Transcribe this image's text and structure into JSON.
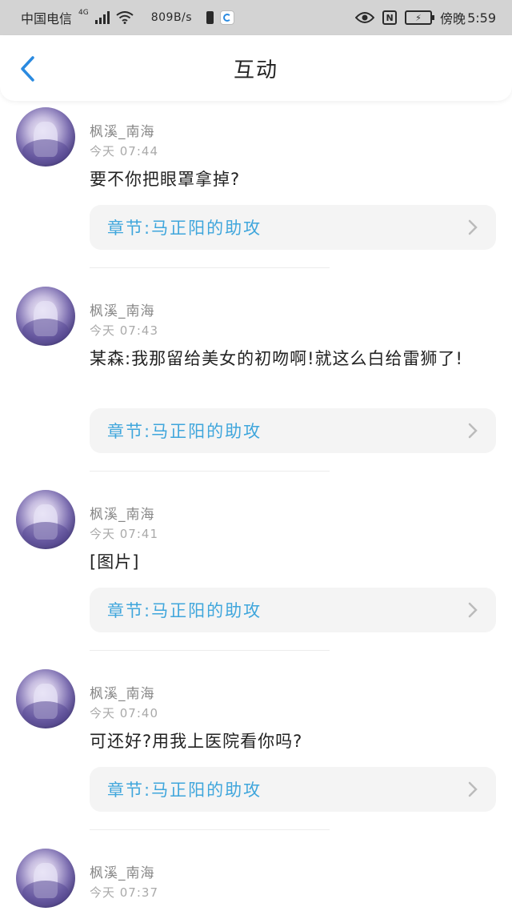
{
  "status_bar": {
    "carrier": "中国电信",
    "network": "4G",
    "speed": "809B/s",
    "alarm_label": "傍晚",
    "time": "5:59"
  },
  "header": {
    "title": "互动",
    "back_icon": "chevron-left-icon"
  },
  "colors": {
    "accent": "#3fa6dc",
    "back_arrow": "#2a8ae0"
  },
  "feed": [
    {
      "username": "枫溪_南海",
      "time": "今天 07:44",
      "comment": "要不你把眼罩拿掉?",
      "chapter": "章节:马正阳的助攻"
    },
    {
      "username": "枫溪_南海",
      "time": "今天 07:43",
      "comment": "某森:我那留给美女的初吻啊!就这么白给雷狮了!",
      "chapter": "章节:马正阳的助攻"
    },
    {
      "username": "枫溪_南海",
      "time": "今天 07:41",
      "comment": "[图片]",
      "chapter": "章节:马正阳的助攻"
    },
    {
      "username": "枫溪_南海",
      "time": "今天 07:40",
      "comment": "可还好?用我上医院看你吗?",
      "chapter": "章节:马正阳的助攻"
    },
    {
      "username": "枫溪_南海",
      "time": "今天 07:37"
    }
  ]
}
